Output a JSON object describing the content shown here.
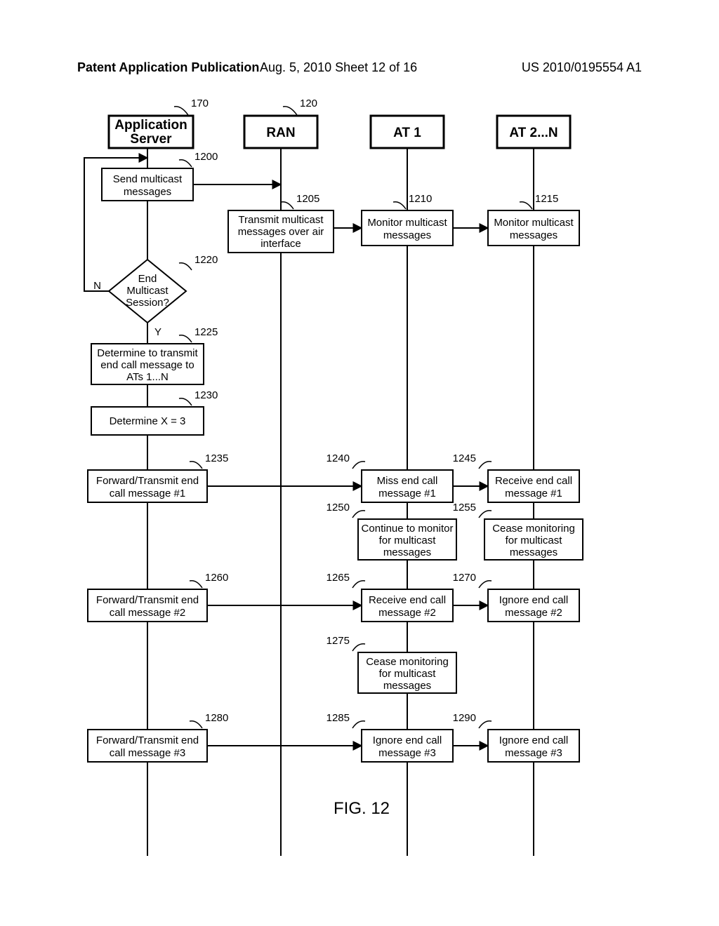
{
  "header": {
    "left": "Patent Application Publication",
    "center": "Aug. 5, 2010   Sheet 12 of 16",
    "right": "US 2010/0195554 A1"
  },
  "figureLabel": "FIG. 12",
  "lanes": {
    "appServer": {
      "title1": "Application",
      "title2": "Server",
      "ref": "170"
    },
    "ran": {
      "title": "RAN",
      "ref": "120"
    },
    "at1": {
      "title": "AT 1"
    },
    "at2n": {
      "title": "AT 2...N"
    }
  },
  "refs": {
    "b1200": "1200",
    "b1205": "1205",
    "b1210": "1210",
    "b1215": "1215",
    "b1220": "1220",
    "b1225": "1225",
    "b1230": "1230",
    "b1235": "1235",
    "b1240": "1240",
    "b1245": "1245",
    "b1250": "1250",
    "b1255": "1255",
    "b1260": "1260",
    "b1265": "1265",
    "b1270": "1270",
    "b1275": "1275",
    "b1280": "1280",
    "b1285": "1285",
    "b1290": "1290"
  },
  "boxes": {
    "b1200": {
      "l1": "Send multicast",
      "l2": "messages"
    },
    "b1205": {
      "l1": "Transmit multicast",
      "l2": "messages over air",
      "l3": "interface"
    },
    "b1210": {
      "l1": "Monitor multicast",
      "l2": "messages"
    },
    "b1215": {
      "l1": "Monitor multicast",
      "l2": "messages"
    },
    "b1220": {
      "l1": "End",
      "l2": "Multicast",
      "l3": "Session?"
    },
    "b1225": {
      "l1": "Determine to transmit",
      "l2": "end call message to",
      "l3": "ATs 1...N"
    },
    "b1230": {
      "l1": "Determine X = 3"
    },
    "b1235": {
      "l1": "Forward/Transmit end",
      "l2": "call message #1"
    },
    "b1240": {
      "l1": "Miss end call",
      "l2": "message #1"
    },
    "b1245": {
      "l1": "Receive end call",
      "l2": "message #1"
    },
    "b1250": {
      "l1": "Continue to monitor",
      "l2": "for multicast",
      "l3": "messages"
    },
    "b1255": {
      "l1": "Cease monitoring",
      "l2": "for multicast",
      "l3": "messages"
    },
    "b1260": {
      "l1": "Forward/Transmit end",
      "l2": "call message #2"
    },
    "b1265": {
      "l1": "Receive end call",
      "l2": "message #2"
    },
    "b1270": {
      "l1": "Ignore end call",
      "l2": "message #2"
    },
    "b1275": {
      "l1": "Cease monitoring",
      "l2": "for multicast",
      "l3": "messages"
    },
    "b1280": {
      "l1": "Forward/Transmit end",
      "l2": "call message #3"
    },
    "b1285": {
      "l1": "Ignore end call",
      "l2": "message #3"
    },
    "b1290": {
      "l1": "Ignore end call",
      "l2": "message #3"
    }
  },
  "decision": {
    "no": "N",
    "yes": "Y"
  }
}
